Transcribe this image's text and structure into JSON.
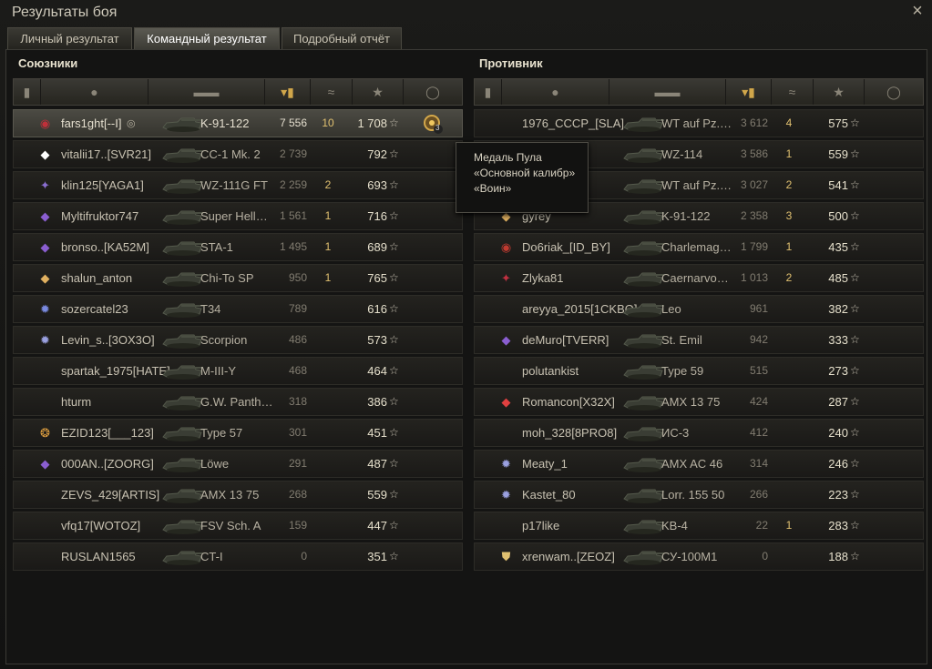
{
  "window": {
    "title": "Результаты боя",
    "close_label": "×"
  },
  "tabs": [
    {
      "label": "Личный результат",
      "active": false
    },
    {
      "label": "Командный результат",
      "active": true
    },
    {
      "label": "Подробный отчёт",
      "active": false
    }
  ],
  "allies": {
    "title": "Союзники",
    "header_icons": [
      "clan-icon",
      "player-icon",
      "tank-icon",
      "sort-arrow-icon",
      "damage-icon",
      "kills-icon",
      "xp-star-icon",
      "medal-icon"
    ],
    "rows": [
      {
        "name": "fars1ght[--I]",
        "tank": "K-91-122",
        "damage": "7 556",
        "kills": "10",
        "xp": "1 708",
        "badge": "rank-icon",
        "badge_color": "#c0303a",
        "player": true,
        "medal": "3"
      },
      {
        "name": "vitalii17..[SVR21]",
        "tank": "CC-1 Mk. 2",
        "damage": "2 739",
        "kills": "",
        "xp": "792",
        "badge": "diamond-icon",
        "badge_color": "#ffffff"
      },
      {
        "name": "klin125[YAGA1]",
        "tank": "WZ-111G FT",
        "damage": "2 259",
        "kills": "2",
        "xp": "693",
        "badge": "wing-icon",
        "badge_color": "#8a6ed0"
      },
      {
        "name": "Myltifruktor747",
        "tank": "Super Hell…",
        "damage": "1 561",
        "kills": "1",
        "xp": "716",
        "badge": "diamond-icon",
        "badge_color": "#8a5ed0"
      },
      {
        "name": "bronso..[KA52M]",
        "tank": "STA-1",
        "damage": "1 495",
        "kills": "1",
        "xp": "689",
        "badge": "diamond-icon",
        "badge_color": "#8a5ed0"
      },
      {
        "name": "shalun_anton",
        "tank": "Chi-To SP",
        "damage": "950",
        "kills": "1",
        "xp": "765",
        "badge": "diamond-icon",
        "badge_color": "#e0b060"
      },
      {
        "name": "sozercatel23",
        "tank": "T34",
        "damage": "789",
        "kills": "",
        "xp": "616",
        "badge": "star-rank-icon",
        "badge_color": "#7a8ae0"
      },
      {
        "name": "Levin_s..[3OX3O]",
        "tank": "Scorpion",
        "damage": "486",
        "kills": "",
        "xp": "573",
        "badge": "star-rank-icon",
        "badge_color": "#9aa0e0"
      },
      {
        "name": "spartak_1975[HATE]",
        "tank": "M-III-Y",
        "damage": "468",
        "kills": "",
        "xp": "464",
        "badge": "",
        "badge_color": ""
      },
      {
        "name": "hturm",
        "tank": "G.W. Panth…",
        "damage": "318",
        "kills": "",
        "xp": "386",
        "badge": "",
        "badge_color": ""
      },
      {
        "name": "EZID123[___123]",
        "tank": "Type 57",
        "damage": "301",
        "kills": "",
        "xp": "451",
        "badge": "ornate-rank-icon",
        "badge_color": "#e0a040"
      },
      {
        "name": "000AN..[ZOORG]",
        "tank": "Löwe",
        "damage": "291",
        "kills": "",
        "xp": "487",
        "badge": "diamond-icon",
        "badge_color": "#8a5ed0"
      },
      {
        "name": "ZEVS_429[ARTIS]",
        "tank": "AMX 13 75",
        "damage": "268",
        "kills": "",
        "xp": "559",
        "badge": "",
        "badge_color": ""
      },
      {
        "name": "vfq17[WOTOZ]",
        "tank": "FSV Sch. A",
        "damage": "159",
        "kills": "",
        "xp": "447",
        "badge": "",
        "badge_color": ""
      },
      {
        "name": "RUSLAN1565",
        "tank": "CT-I",
        "damage": "0",
        "kills": "",
        "xp": "351",
        "badge": "",
        "badge_color": ""
      }
    ]
  },
  "enemies": {
    "title": "Противник",
    "header_icons": [
      "clan-icon",
      "player-icon",
      "tank-icon",
      "sort-arrow-icon",
      "damage-icon",
      "kills-icon",
      "xp-star-icon",
      "medal-icon"
    ],
    "rows": [
      {
        "name": "1976_CCCP_[SLA]",
        "tank": "WT auf Pz.…",
        "damage": "3 612",
        "kills": "4",
        "xp": "575",
        "badge": "",
        "badge_color": ""
      },
      {
        "name": "",
        "name_visible": "PO]",
        "tank": "WZ-114",
        "damage": "3 586",
        "kills": "1",
        "xp": "559",
        "badge": "",
        "badge_color": ""
      },
      {
        "name": "",
        "name_visible": "E_]",
        "tank": "WT auf Pz.…",
        "damage": "3 027",
        "kills": "2",
        "xp": "541",
        "badge": "",
        "badge_color": ""
      },
      {
        "name": "gyrey",
        "tank": "K-91-122",
        "damage": "2 358",
        "kills": "3",
        "xp": "500",
        "badge": "diamond-icon",
        "badge_color": "#e0b060"
      },
      {
        "name": "Do6riak_[ID_BY]",
        "tank": "Charlemag…",
        "damage": "1 799",
        "kills": "1",
        "xp": "435",
        "badge": "rank-icon",
        "badge_color": "#c03a30"
      },
      {
        "name": "Zlyka81",
        "tank": "Caernarvo…",
        "damage": "1 013",
        "kills": "2",
        "xp": "485",
        "badge": "wing-icon",
        "badge_color": "#c03040"
      },
      {
        "name": "areyya_2015[1CKBO]",
        "tank": "Leo",
        "damage": "961",
        "kills": "",
        "xp": "382",
        "badge": "",
        "badge_color": ""
      },
      {
        "name": "deMuro[TVERR]",
        "tank": "St. Emil",
        "damage": "942",
        "kills": "",
        "xp": "333",
        "badge": "diamond-icon",
        "badge_color": "#8a5ed0"
      },
      {
        "name": "polutankist",
        "tank": "Type 59",
        "damage": "515",
        "kills": "",
        "xp": "273",
        "badge": "",
        "badge_color": ""
      },
      {
        "name": "Romancon[X32X]",
        "tank": "AMX 13 75",
        "damage": "424",
        "kills": "",
        "xp": "287",
        "badge": "diamond-icon",
        "badge_color": "#e04040"
      },
      {
        "name": "moh_328[8PRO8]",
        "tank": "ИС-3",
        "damage": "412",
        "kills": "",
        "xp": "240",
        "badge": "",
        "badge_color": ""
      },
      {
        "name": "Meaty_1",
        "tank": "AMX AC 46",
        "damage": "314",
        "kills": "",
        "xp": "246",
        "badge": "star-rank-icon",
        "badge_color": "#9aa0e0"
      },
      {
        "name": "Kastet_80",
        "tank": "Lorr. 155 50",
        "damage": "266",
        "kills": "",
        "xp": "223",
        "badge": "star-rank-icon",
        "badge_color": "#9aa0e0"
      },
      {
        "name": "p17like",
        "tank": "KB-4",
        "damage": "22",
        "kills": "1",
        "xp": "283",
        "badge": "",
        "badge_color": ""
      },
      {
        "name": "xrenwam..[ZEOZ]",
        "tank": "СУ-100М1",
        "damage": "0",
        "kills": "",
        "xp": "188",
        "badge": "shield-rank-icon",
        "badge_color": "#e0c070"
      }
    ]
  },
  "tooltip": {
    "line1": "Медаль Пула",
    "line2": "«Основной калибр»",
    "line3": "«Воин»"
  }
}
